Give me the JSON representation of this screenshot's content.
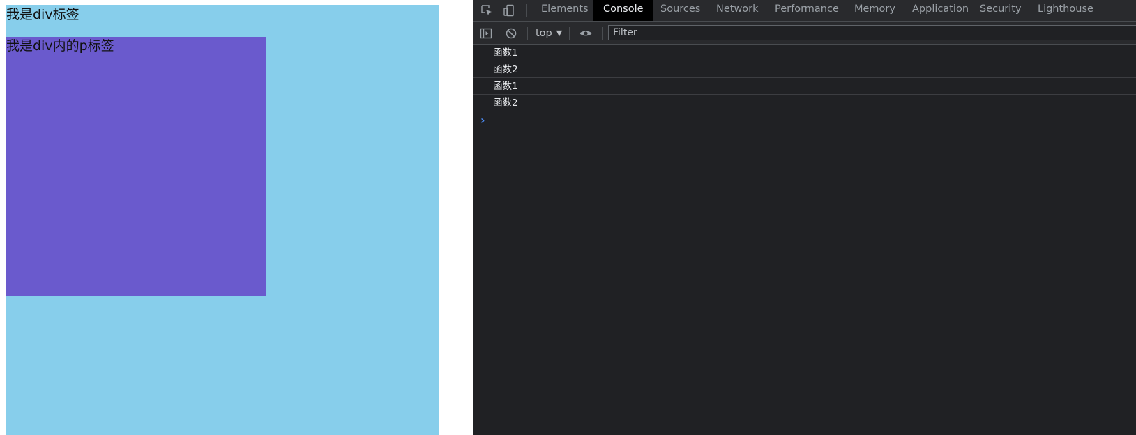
{
  "page": {
    "outer_div_text": "我是div标签",
    "inner_p_text": "我是div内的p标签",
    "colors": {
      "outer_div_bg": "#87ceeb",
      "inner_p_bg": "#6a5acd"
    }
  },
  "devtools": {
    "icons": {
      "inspect": "element-picker-icon",
      "device": "device-toolbar-icon",
      "sidebar": "console-sidebar-icon",
      "clear": "clear-console-icon",
      "eye": "live-expression-icon",
      "prompt": "console-prompt-chevron-icon"
    },
    "tabs": [
      {
        "label": "Elements",
        "active": false
      },
      {
        "label": "Console",
        "active": true
      },
      {
        "label": "Sources",
        "active": false
      },
      {
        "label": "Network",
        "active": false
      },
      {
        "label": "Performance",
        "active": false
      },
      {
        "label": "Memory",
        "active": false
      },
      {
        "label": "Application",
        "active": false
      },
      {
        "label": "Security",
        "active": false
      },
      {
        "label": "Lighthouse",
        "active": false
      }
    ],
    "toolbar": {
      "context": "top",
      "filter_placeholder": "Filter"
    },
    "console_messages": [
      {
        "text": "函数1"
      },
      {
        "text": "函数2"
      },
      {
        "text": "函数1"
      },
      {
        "text": "函数2"
      }
    ],
    "colors": {
      "panel_bg": "#202124",
      "accent_prompt": "#4c8df6"
    }
  }
}
